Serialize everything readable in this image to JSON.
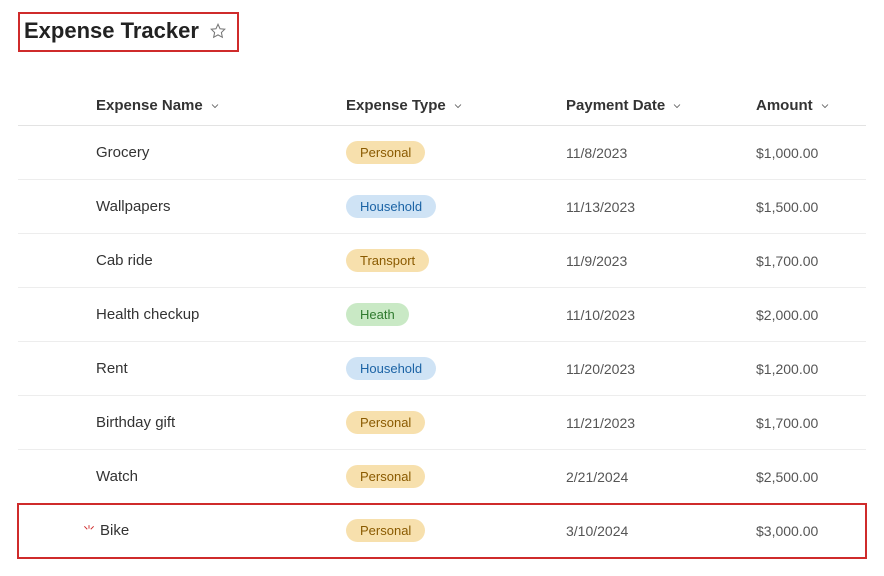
{
  "header": {
    "title": "Expense Tracker"
  },
  "columns": {
    "name": "Expense Name",
    "type": "Expense Type",
    "date": "Payment Date",
    "amount": "Amount"
  },
  "badge_class": {
    "Personal": "badge-personal",
    "Household": "badge-household",
    "Transport": "badge-transport",
    "Heath": "badge-health"
  },
  "rows": [
    {
      "name": "Grocery",
      "type": "Personal",
      "date": "11/8/2023",
      "amount": "$1,000.00",
      "highlight": false,
      "spark": false
    },
    {
      "name": "Wallpapers",
      "type": "Household",
      "date": "11/13/2023",
      "amount": "$1,500.00",
      "highlight": false,
      "spark": false
    },
    {
      "name": "Cab ride",
      "type": "Transport",
      "date": "11/9/2023",
      "amount": "$1,700.00",
      "highlight": false,
      "spark": false
    },
    {
      "name": "Health checkup",
      "type": "Heath",
      "date": "11/10/2023",
      "amount": "$2,000.00",
      "highlight": false,
      "spark": false
    },
    {
      "name": "Rent",
      "type": "Household",
      "date": "11/20/2023",
      "amount": "$1,200.00",
      "highlight": false,
      "spark": false
    },
    {
      "name": "Birthday gift",
      "type": "Personal",
      "date": "11/21/2023",
      "amount": "$1,700.00",
      "highlight": false,
      "spark": false
    },
    {
      "name": "Watch",
      "type": "Personal",
      "date": "2/21/2024",
      "amount": "$2,500.00",
      "highlight": false,
      "spark": false
    },
    {
      "name": "Bike",
      "type": "Personal",
      "date": "3/10/2024",
      "amount": "$3,000.00",
      "highlight": true,
      "spark": true
    }
  ]
}
